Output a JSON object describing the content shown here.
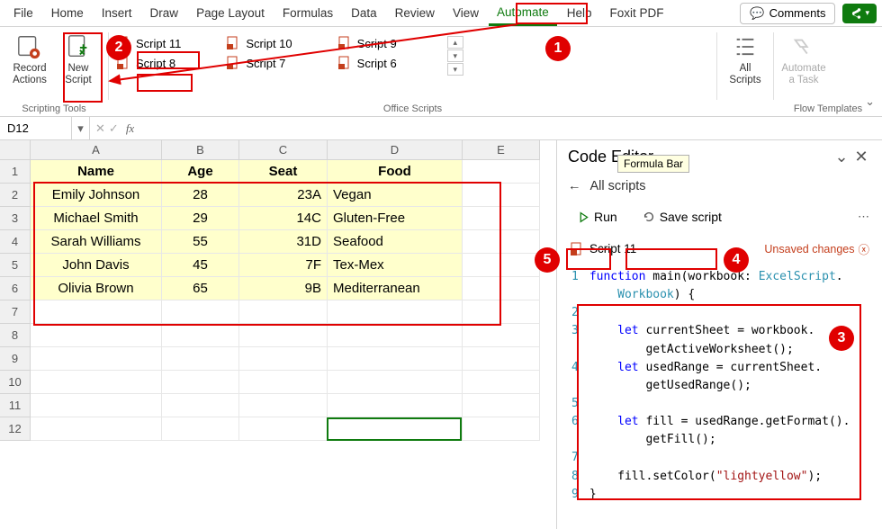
{
  "tabs": {
    "file": "File",
    "home": "Home",
    "insert": "Insert",
    "draw": "Draw",
    "page_layout": "Page Layout",
    "formulas": "Formulas",
    "data": "Data",
    "review": "Review",
    "view": "View",
    "automate": "Automate",
    "help": "Help",
    "foxit": "Foxit PDF",
    "comments": "Comments"
  },
  "ribbon": {
    "record_actions": "Record Actions",
    "new_script": "New Script",
    "all_scripts": "All Scripts",
    "automate_task": "Automate a Task",
    "group_scripting": "Scripting Tools",
    "group_office": "Office Scripts",
    "group_flow": "Flow Templates",
    "scripts": {
      "s11": "Script 11",
      "s10": "Script 10",
      "s9": "Script 9",
      "s8": "Script 8",
      "s7": "Script 7",
      "s6": "Script 6"
    }
  },
  "namebox": "D12",
  "formula_tip": "Formula Bar",
  "columns": {
    "A": "A",
    "B": "B",
    "C": "C",
    "D": "D",
    "E": "E"
  },
  "headers": {
    "name": "Name",
    "age": "Age",
    "seat": "Seat",
    "food": "Food"
  },
  "rows": [
    {
      "r": "1"
    },
    {
      "r": "2",
      "name": "Emily Johnson",
      "age": "28",
      "seat": "23A",
      "food": "Vegan"
    },
    {
      "r": "3",
      "name": "Michael Smith",
      "age": "29",
      "seat": "14C",
      "food": "Gluten-Free"
    },
    {
      "r": "4",
      "name": "Sarah Williams",
      "age": "55",
      "seat": "31D",
      "food": "Seafood"
    },
    {
      "r": "5",
      "name": "John Davis",
      "age": "45",
      "seat": "7F",
      "food": "Tex-Mex"
    },
    {
      "r": "6",
      "name": "Olivia Brown",
      "age": "65",
      "seat": "9B",
      "food": "Mediterranean"
    },
    {
      "r": "7"
    },
    {
      "r": "8"
    },
    {
      "r": "9"
    },
    {
      "r": "10"
    },
    {
      "r": "11"
    },
    {
      "r": "12"
    }
  ],
  "editor": {
    "title": "Code Editor",
    "back": "←",
    "breadcrumb": "All scripts",
    "run": "Run",
    "save": "Save script",
    "script_name": "Script 11",
    "unsaved": "Unsaved changes",
    "ln": {
      "1": "1",
      "2": "2",
      "3": "3",
      "4": "4",
      "5": "5",
      "6": "6",
      "7": "7",
      "8": "8",
      "9": "9"
    },
    "code": {
      "l1a": "function",
      "l1b": " main(workbook: ",
      "l1c": "ExcelScript",
      "l1d": ".",
      "l2a": "    Workbook",
      "l2b": ") {",
      "l3a": "    let",
      "l3b": " currentSheet = workbook.",
      "l3c": "        getActiveWorksheet();",
      "l4a": "    let",
      "l4b": " usedRange = currentSheet.",
      "l4c": "        getUsedRange();",
      "l6a": "    let",
      "l6b": " fill = usedRange.getFormat().",
      "l6c": "        getFill();",
      "l8a": "    fill.setColor(",
      "l8b": "\"lightyellow\"",
      "l8c": ");",
      "l9": "}"
    }
  },
  "bubbles": {
    "1": "1",
    "2": "2",
    "3": "3",
    "4": "4",
    "5": "5"
  }
}
